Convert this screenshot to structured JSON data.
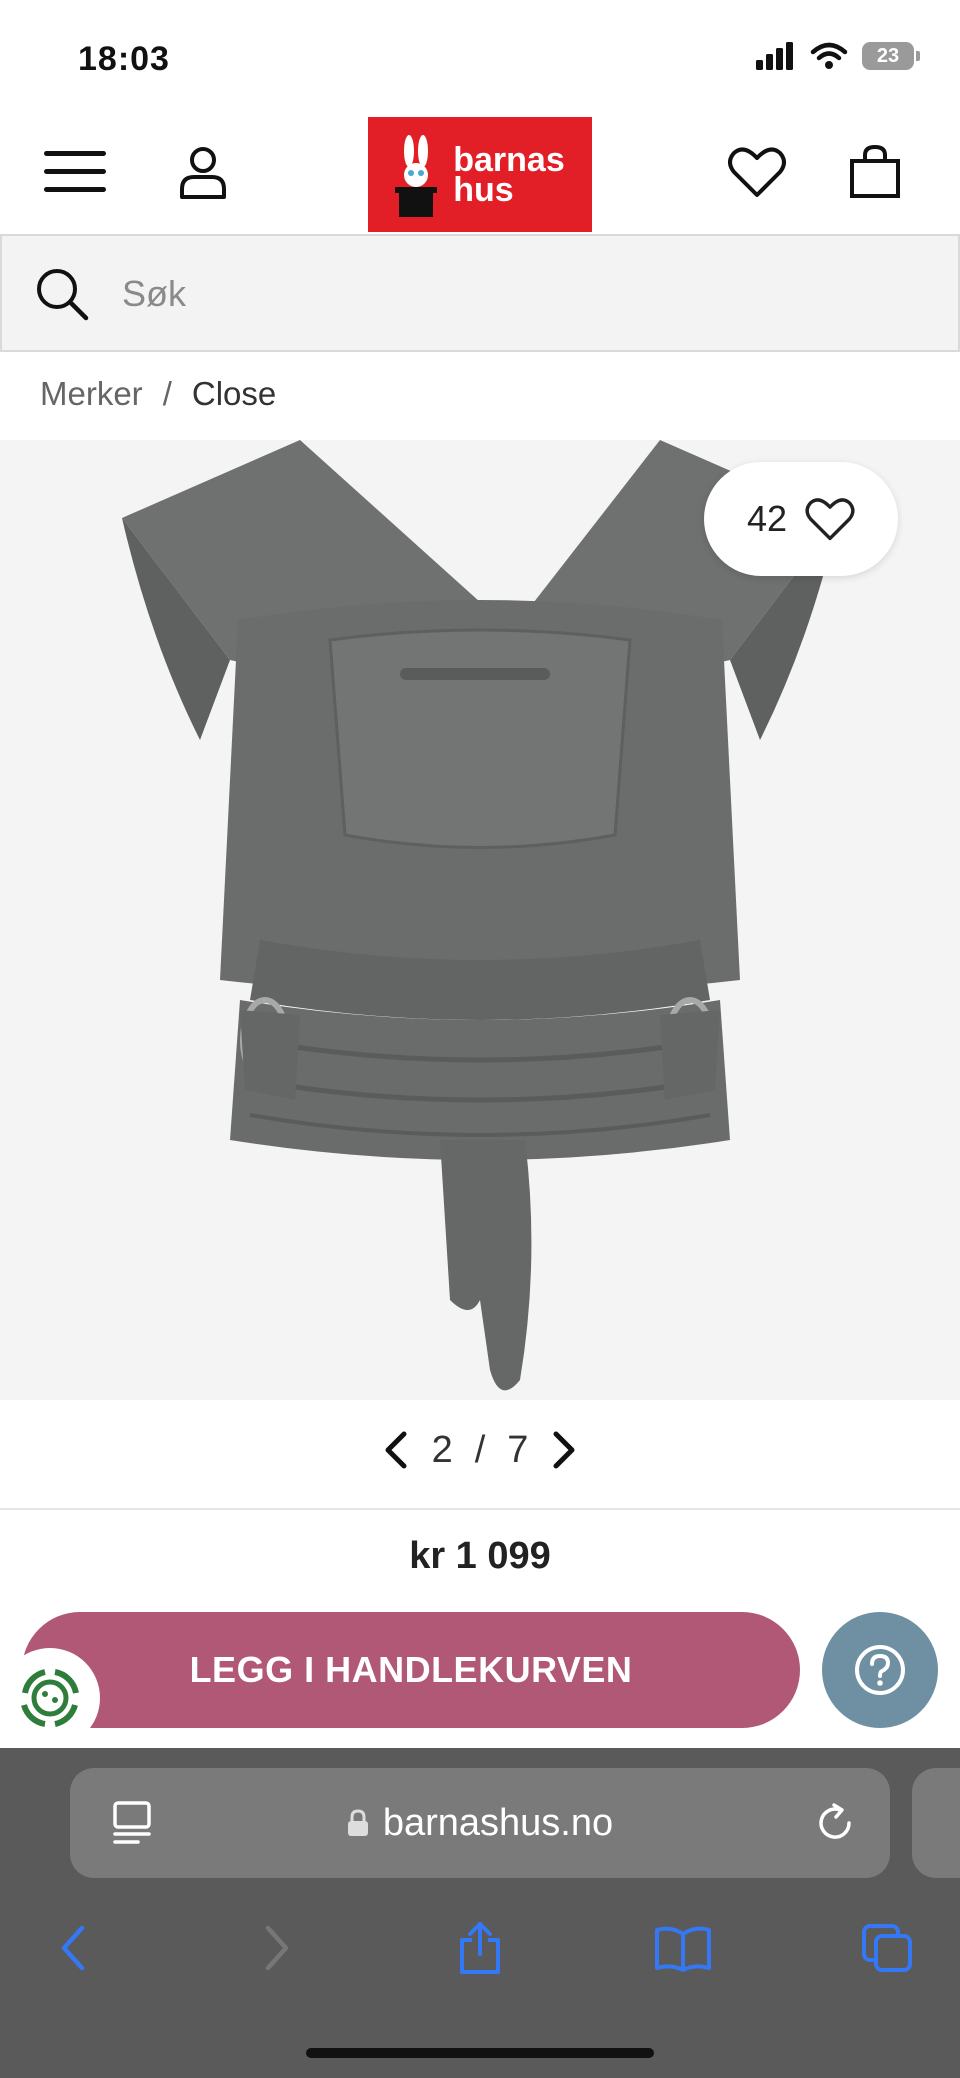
{
  "status_bar": {
    "time": "18:03",
    "battery": "23"
  },
  "header": {
    "logo_text_line1": "barnas",
    "logo_text_line2": "hus"
  },
  "search": {
    "placeholder": "Søk"
  },
  "breadcrumb": {
    "parent": "Merker",
    "separator": "/",
    "current": "Close"
  },
  "product": {
    "favorites_count": "42",
    "image_alt": "Close bæresele grå"
  },
  "pager": {
    "current": "2",
    "separator": "/",
    "total": "7"
  },
  "price": "kr 1 099",
  "cart": {
    "button_label": "LEGG I HANDLEKURVEN"
  },
  "browser": {
    "url": "barnashus.no"
  },
  "colors": {
    "brand_red": "#e21f26",
    "cart_button": "#b15876",
    "help_button": "#6f8fa3",
    "browser_chrome": "#5a5a5a",
    "browser_blue": "#3478f6"
  }
}
